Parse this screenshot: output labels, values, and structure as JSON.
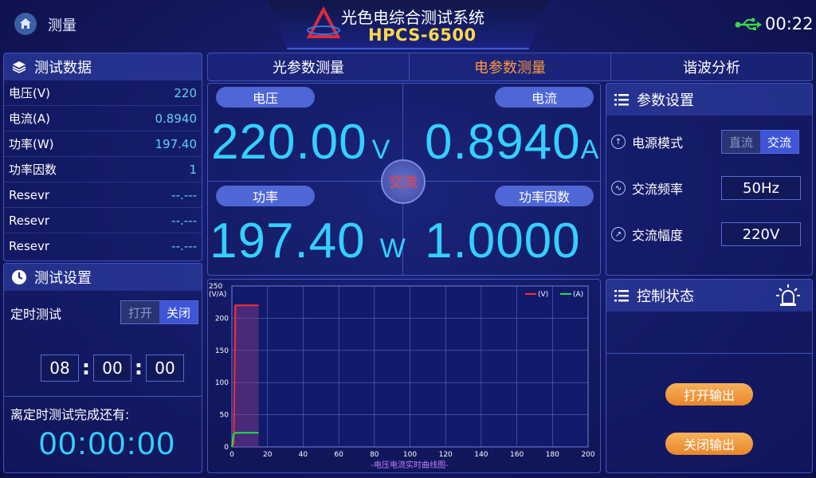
{
  "header": {
    "home_label": "测量",
    "title": "光色电综合测试系统",
    "model": "HPCS-6500",
    "time": "00:22"
  },
  "test_data": {
    "title": "测试数据",
    "rows": [
      {
        "label": "电压(V)",
        "value": "220"
      },
      {
        "label": "电流(A)",
        "value": "0.8940"
      },
      {
        "label": "功率(W)",
        "value": "197.40"
      },
      {
        "label": "功率因数",
        "value": "1"
      },
      {
        "label": "Resevr",
        "value": "--.---"
      },
      {
        "label": "Resevr",
        "value": "--.---"
      },
      {
        "label": "Resevr",
        "value": "--.---"
      }
    ]
  },
  "timer": {
    "title": "测试设置",
    "timed_test_label": "定时测试",
    "toggle_on": "打开",
    "toggle_off": "关闭",
    "hours": "08",
    "minutes": "00",
    "seconds": "00",
    "colon": ":",
    "remaining_label": "离定时测试完成还有:",
    "remaining": "00:00:00"
  },
  "tabs": [
    {
      "label": "光参数测量"
    },
    {
      "label": "电参数测量"
    },
    {
      "label": "谐波分析"
    }
  ],
  "measure": {
    "voltage_label": "电压",
    "voltage": "220.00",
    "voltage_unit": "V",
    "current_label": "电流",
    "current": "0.8940",
    "current_unit": "A",
    "power_label": "功率",
    "power": "197.40",
    "power_unit": "W",
    "pf_label": "功率因数",
    "pf": "1.0000",
    "mode_badge": "交流"
  },
  "params": {
    "title": "参数设置",
    "power_mode_label": "电源模式",
    "mode_dc": "直流",
    "mode_ac": "交流",
    "ac_freq_label": "交流频率",
    "ac_freq": "50Hz",
    "ac_amp_label": "交流幅度",
    "ac_amp": "220V"
  },
  "control": {
    "title": "控制状态",
    "open_output": "打开输出",
    "close_output": "关闭输出"
  },
  "colors": {
    "accent_value": "#33d0ff",
    "active_tab": "#ff9a3c",
    "voltage_line": "#ff2b2b",
    "current_line": "#22e04a",
    "ac_badge_text": "#ff3d3d",
    "model_text": "#ffd94a"
  },
  "chart_data": {
    "type": "line",
    "title": "",
    "xlabel": "-电压电流实时曲线图-",
    "ylabel": "(V/A)",
    "xlim": [
      0,
      200
    ],
    "ylim": [
      0,
      250
    ],
    "x_ticks": [
      "0",
      "20",
      "40",
      "60",
      "80",
      "100",
      "120",
      "140",
      "160",
      "180",
      "200"
    ],
    "y_ticks": [
      "0",
      "50",
      "100",
      "150",
      "200",
      "250"
    ],
    "grid": true,
    "legend_position": "top-right",
    "series": [
      {
        "name": "(V)",
        "color": "#ff2b2b",
        "x": [
          0,
          1,
          2,
          15
        ],
        "y": [
          0,
          5,
          220,
          220
        ]
      },
      {
        "name": "(A)",
        "color": "#22e04a",
        "x": [
          0,
          1,
          2,
          15
        ],
        "y": [
          0,
          20,
          22,
          22
        ]
      }
    ]
  }
}
